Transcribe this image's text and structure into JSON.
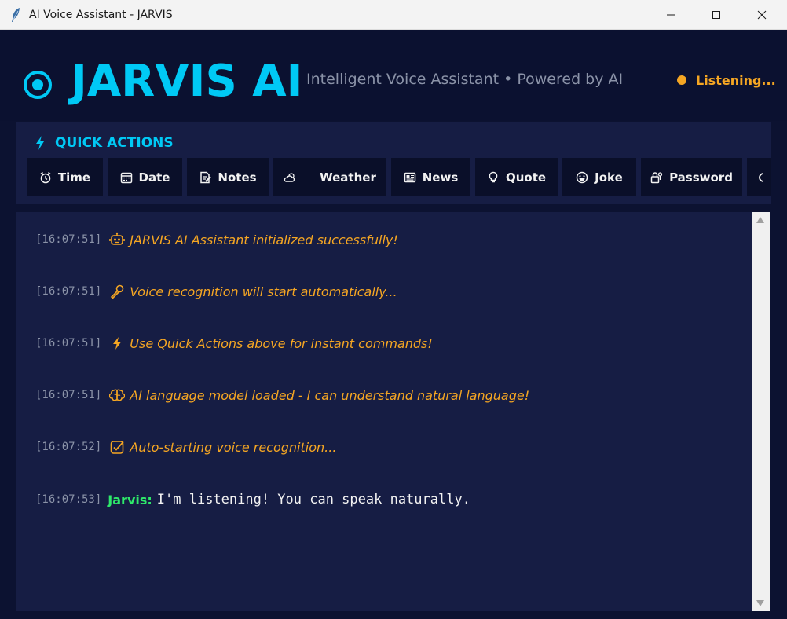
{
  "window": {
    "title": "AI Voice Assistant - JARVIS",
    "controls": [
      "minimize-icon",
      "maximize-icon",
      "close-icon"
    ]
  },
  "header": {
    "brand_icon": "target-icon",
    "brand": "JARVIS AI",
    "subtitle": "Intelligent Voice Assistant • Powered by AI",
    "status": "Listening...",
    "status_color": "#f5a623"
  },
  "quick_actions": {
    "title": "QUICK ACTIONS",
    "icon": "lightning-icon",
    "buttons": [
      {
        "label": "Time",
        "icon": "alarm-clock-icon"
      },
      {
        "label": "Date",
        "icon": "calendar-icon"
      },
      {
        "label": "Notes",
        "icon": "memo-icon"
      },
      {
        "label": "Weather",
        "icon": "cloud-sun-icon"
      },
      {
        "label": "News",
        "icon": "newspaper-icon"
      },
      {
        "label": "Quote",
        "icon": "lightbulb-icon"
      },
      {
        "label": "Joke",
        "icon": "laughing-face-icon"
      },
      {
        "label": "Password",
        "icon": "lock-key-icon"
      }
    ]
  },
  "chat": {
    "messages": [
      {
        "time": "[16:07:51]",
        "icon": "robot-icon",
        "text": "JARVIS AI Assistant initialized successfully!"
      },
      {
        "time": "[16:07:51]",
        "icon": "microphone-icon",
        "text": "Voice recognition will start automatically..."
      },
      {
        "time": "[16:07:51]",
        "icon": "lightning-icon",
        "text": "Use Quick Actions above for instant commands!"
      },
      {
        "time": "[16:07:51]",
        "icon": "brain-icon",
        "text": "AI language model loaded - I can understand natural language!"
      },
      {
        "time": "[16:07:52]",
        "icon": "check-box-icon",
        "text": "Auto-starting voice recognition..."
      },
      {
        "time": "[16:07:53]",
        "speaker": "Jarvis:",
        "text": "I'm listening! You can speak naturally."
      }
    ]
  },
  "colors": {
    "accent": "#00c9f5",
    "system_text": "#f5a623",
    "speaker": "#2ee86a",
    "background": "#0c1231",
    "panel": "#161d44"
  }
}
